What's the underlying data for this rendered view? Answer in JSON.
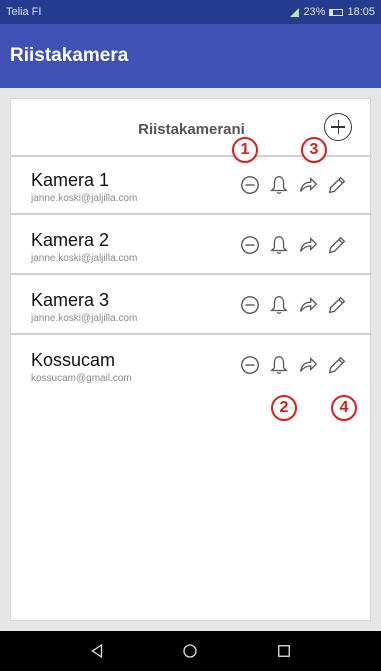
{
  "status_bar": {
    "carrier": "Telia FI",
    "battery": "23%",
    "battery_level": 0.23,
    "time": "18:05"
  },
  "app_bar": {
    "title": "Riistakamera"
  },
  "card": {
    "title": "Riistakamerani",
    "add_icon": "plus-circle-icon"
  },
  "cameras": [
    {
      "name": "Kamera 1",
      "email": "janne.koski@jaljilla.com"
    },
    {
      "name": "Kamera 2",
      "email": "janne.koski@jaljilla.com"
    },
    {
      "name": "Kamera 3",
      "email": "janne.koski@jaljilla.com"
    },
    {
      "name": "Kossucam",
      "email": "kossucam@gmail.com"
    }
  ],
  "row_icons": [
    "remove-icon",
    "bell-icon",
    "share-icon",
    "edit-icon"
  ],
  "annotations": [
    "1",
    "2",
    "3",
    "4"
  ],
  "colors": {
    "status_bar": "#243b8f",
    "app_bar": "#3f51b5",
    "annotation": "#d42020"
  },
  "nav_icons": [
    "back-icon",
    "home-icon",
    "recents-icon"
  ]
}
